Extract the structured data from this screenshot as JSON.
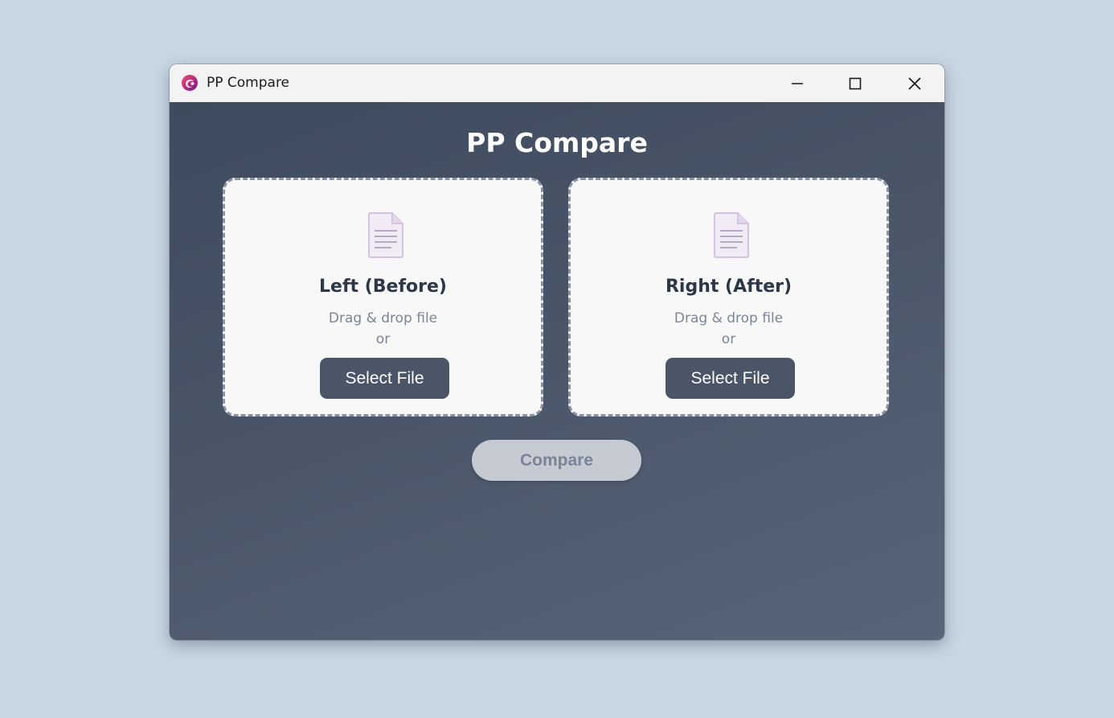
{
  "window": {
    "title": "PP Compare",
    "controls": {
      "minimize": "minimize-icon",
      "maximize": "maximize-icon",
      "close": "close-icon"
    }
  },
  "main": {
    "heading": "PP Compare",
    "left_zone": {
      "icon": "document-icon",
      "title": "Left (Before)",
      "hint": "Drag & drop file",
      "or": "or",
      "button_label": "Select File"
    },
    "right_zone": {
      "icon": "document-icon",
      "title": "Right (After)",
      "hint": "Drag & drop file",
      "or": "or",
      "button_label": "Select File"
    },
    "compare_button": {
      "label": "Compare",
      "state": "disabled"
    }
  },
  "colors": {
    "background": "#c8d5e2",
    "titlebar": "#f3f3f3",
    "content_gradient_start": "#3e4a5e",
    "content_gradient_end": "#586579",
    "drop_zone": "#f8f8f9",
    "drop_zone_border": "#8a93a6",
    "select_button": "#4a5568",
    "compare_button_disabled": "#c6cad3",
    "compare_text_disabled": "#7a8497",
    "document_icon": "#d8c6e2"
  }
}
